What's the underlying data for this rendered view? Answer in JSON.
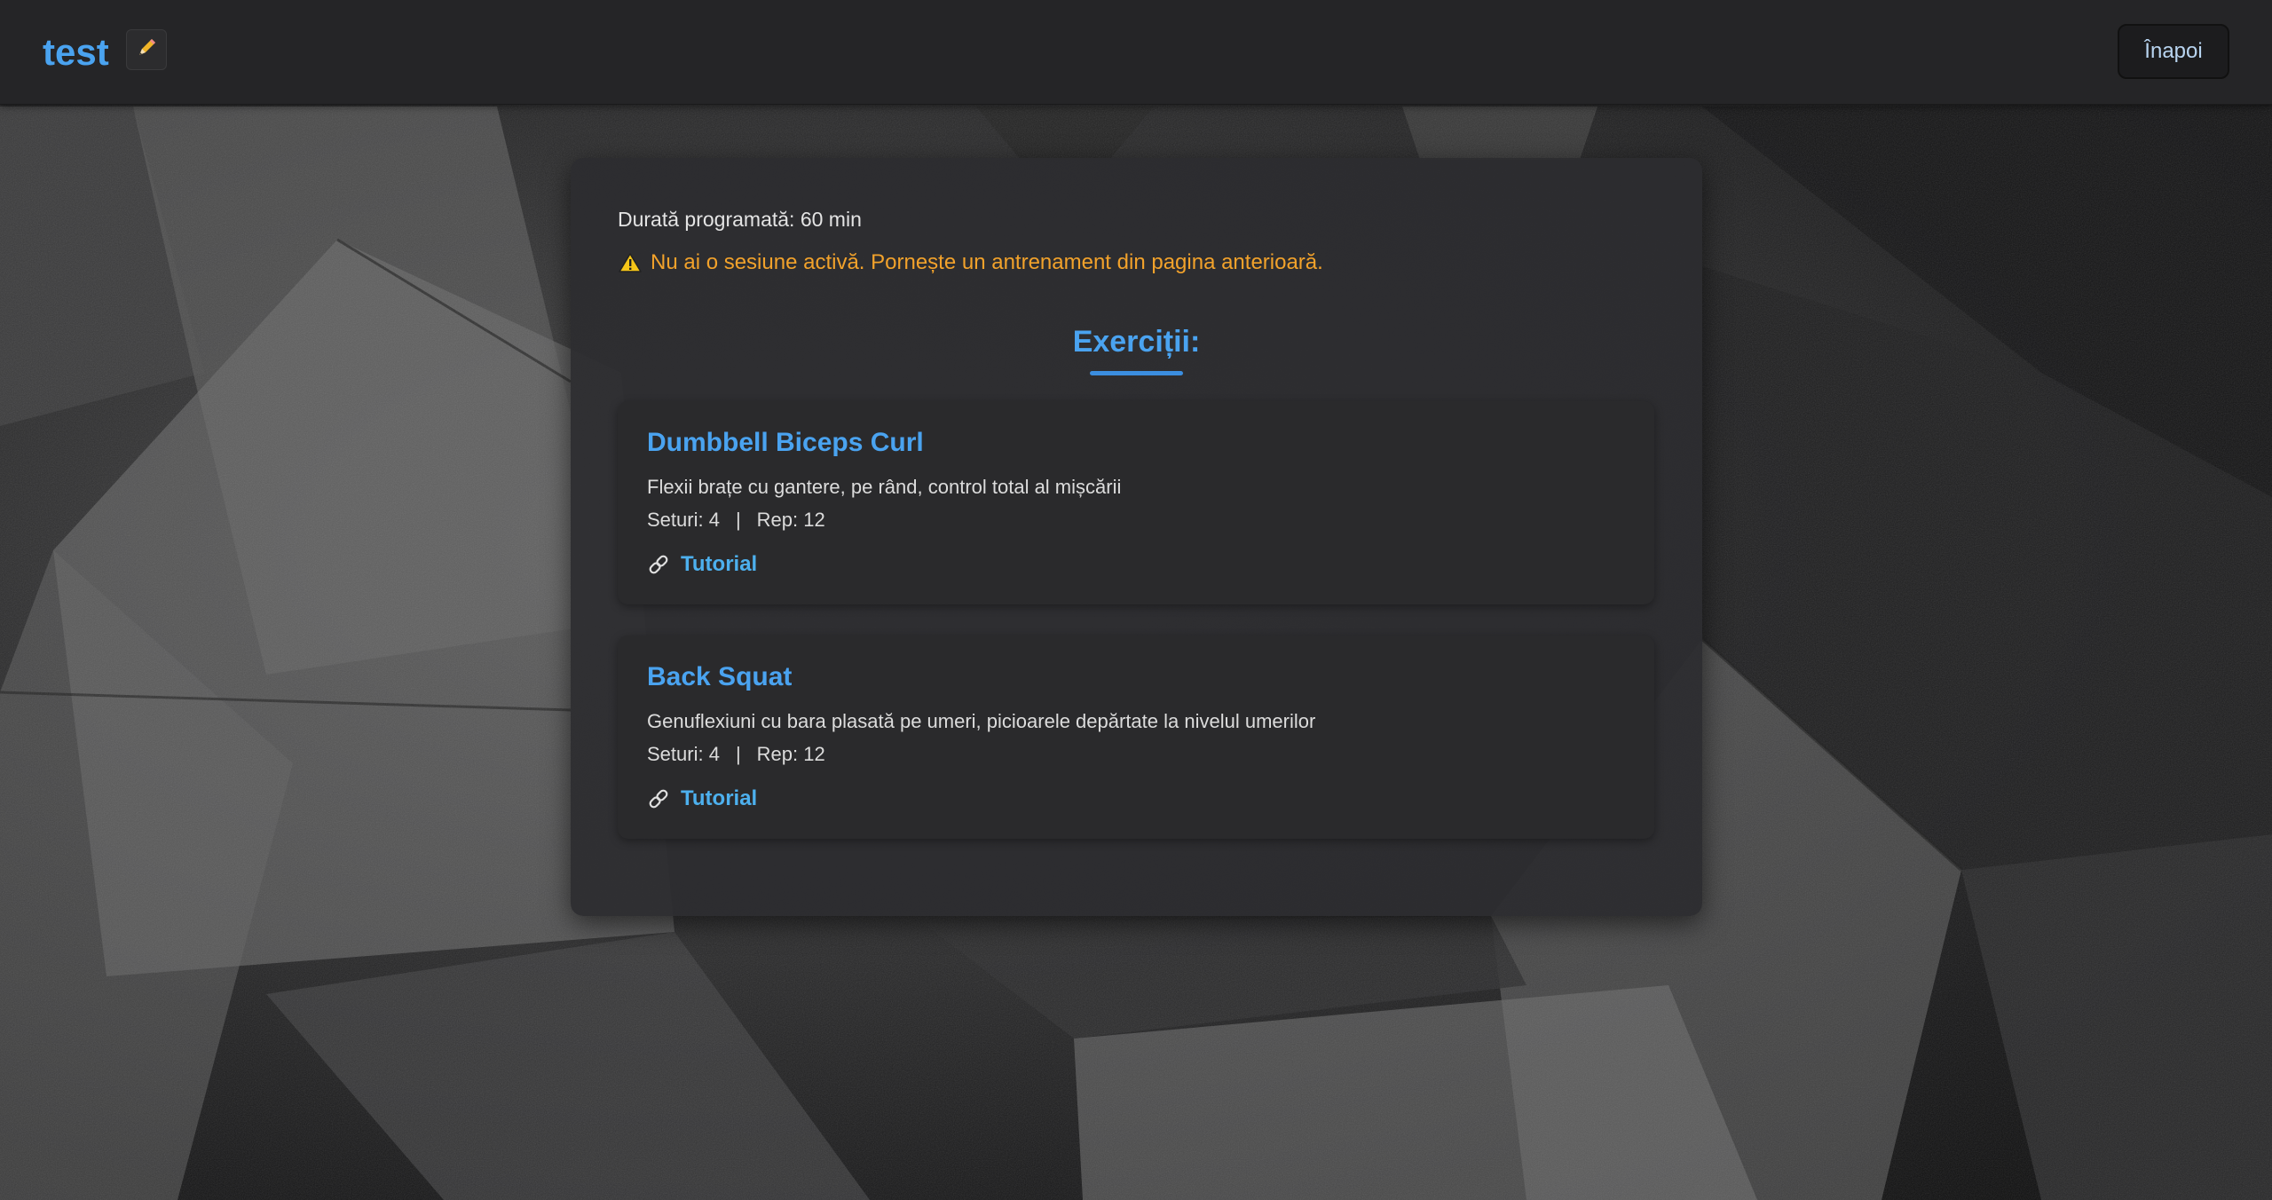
{
  "header": {
    "title": "test",
    "edit_icon": "pencil-icon",
    "back_label": "Înapoi"
  },
  "workout": {
    "duration_label": "Durată programată: 60 min",
    "warning_icon": "warning-icon",
    "warning_text": "Nu ai o sesiune activă. Pornește un antrenament din pagina anterioară.",
    "exercises_heading": "Exerciții:"
  },
  "exercises": [
    {
      "name": "Dumbbell Biceps Curl",
      "description": "Flexii brațe cu gantere, pe rând, control total al mișcării",
      "sets": "Seturi: 4",
      "separator": "|",
      "reps": "Rep: 12",
      "link_icon": "link-icon",
      "tutorial_label": "Tutorial"
    },
    {
      "name": "Back Squat",
      "description": "Genuflexiuni cu bara plasată pe umeri, picioarele depărtate la nivelul umerilor",
      "sets": "Seturi: 4",
      "separator": "|",
      "reps": "Rep: 12",
      "link_icon": "link-icon",
      "tutorial_label": "Tutorial"
    }
  ],
  "colors": {
    "accent": "#4aa3f0",
    "warning": "#f2a22b",
    "header_bg": "#252527",
    "panel_bg": "#2c2c2f",
    "card_bg": "#2a2a2c"
  }
}
